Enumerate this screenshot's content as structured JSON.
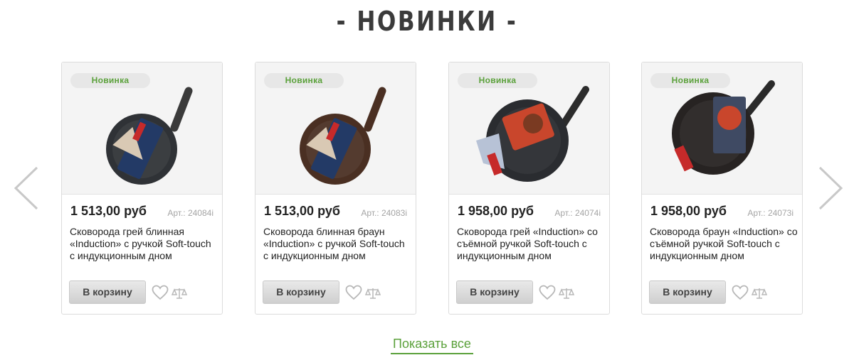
{
  "section": {
    "title": "- НОВИНКИ -"
  },
  "nav": {
    "prev": "chevron-left",
    "next": "chevron-right"
  },
  "colors": {
    "accent": "#5ba13b",
    "badge_bg": "#e7e7e7"
  },
  "products": [
    {
      "badge": "Новинка",
      "price": "1 513,00 руб",
      "article": "Арт.: 24084i",
      "title": "Сковорода грей блинная «Induction» с ручкой Soft-touch с индукционным дном",
      "cart_label": "В корзину",
      "pan_color": "#2f3236"
    },
    {
      "badge": "Новинка",
      "price": "1 513,00 руб",
      "article": "Арт.: 24083i",
      "title": "Сковорода блинная браун «Induction» с ручкой Soft-touch с индукционным дном",
      "cart_label": "В корзину",
      "pan_color": "#4a2f22"
    },
    {
      "badge": "Новинка",
      "price": "1 958,00 руб",
      "article": "Арт.: 24074i",
      "title": "Сковорода грей «Induction» со съёмной ручкой Soft-touch с индукционным дном",
      "cart_label": "В корзину",
      "pan_color": "#2a2c30"
    },
    {
      "badge": "Новинка",
      "price": "1 958,00 руб",
      "article": "Арт.: 24073i",
      "title": "Сковорода браун «Induction» со съёмной ручкой Soft-touch с индукционным дном",
      "cart_label": "В корзину",
      "pan_color": "#272322"
    }
  ],
  "footer": {
    "show_all": "Показать все"
  }
}
